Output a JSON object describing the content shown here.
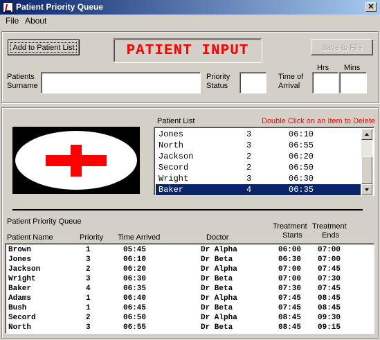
{
  "window": {
    "title": "Patient Priority Queue",
    "close_glyph": "✕"
  },
  "menu": [
    {
      "label": "File"
    },
    {
      "label": "About"
    }
  ],
  "input_panel": {
    "add_button": "Add to Patient List",
    "banner": "PATIENT INPUT",
    "save_button": "Save to File",
    "surname_label_1": "Patients",
    "surname_label_2": "Surname",
    "surname_value": "",
    "priority_label_1": "Priority",
    "priority_label_2": "Status",
    "priority_value": "",
    "arrival_label_1": "Time of",
    "arrival_label_2": "Arrival",
    "hrs_label": "Hrs",
    "mins_label": "Mins",
    "hrs_value": "",
    "mins_value": ""
  },
  "patient_list": {
    "label": "Patient List",
    "hint": "Double Click on an Item to Delete",
    "hint_color": "#ff0000",
    "rows": [
      {
        "name": "Jones",
        "priority": "3",
        "time": "06:10"
      },
      {
        "name": "North",
        "priority": "3",
        "time": "06:55"
      },
      {
        "name": "Jackson",
        "priority": "2",
        "time": "06:20"
      },
      {
        "name": "Secord",
        "priority": "2",
        "time": "06:50"
      },
      {
        "name": "Wright",
        "priority": "3",
        "time": "06:30"
      },
      {
        "name": "Baker",
        "priority": "4",
        "time": "06:35"
      }
    ],
    "selected_index": 5
  },
  "queue": {
    "title": "Patient Priority Queue",
    "headers": {
      "name": "Patient Name",
      "priority": "Priority",
      "time": "Time Arrived",
      "doctor": "Doctor",
      "starts_1": "Treatment",
      "starts_2": "Starts",
      "ends_1": "Treatment",
      "ends_2": "Ends"
    },
    "rows": [
      {
        "name": "Brown",
        "priority": "1",
        "time": "05:45",
        "doctor": "Dr Alpha",
        "starts": "06:00",
        "ends": "07:00"
      },
      {
        "name": "Jones",
        "priority": "3",
        "time": "06:10",
        "doctor": "Dr Beta",
        "starts": "06:30",
        "ends": "07:00"
      },
      {
        "name": "Jackson",
        "priority": "2",
        "time": "06:20",
        "doctor": "Dr Alpha",
        "starts": "07:00",
        "ends": "07:45"
      },
      {
        "name": "Wright",
        "priority": "3",
        "time": "06:30",
        "doctor": "Dr Beta",
        "starts": "07:00",
        "ends": "07:30"
      },
      {
        "name": "Baker",
        "priority": "4",
        "time": "06:35",
        "doctor": "Dr Beta",
        "starts": "07:30",
        "ends": "07:45"
      },
      {
        "name": "Adams",
        "priority": "1",
        "time": "06:40",
        "doctor": "Dr Alpha",
        "starts": "07:45",
        "ends": "08:45"
      },
      {
        "name": "Bush",
        "priority": "1",
        "time": "06:45",
        "doctor": "Dr Beta",
        "starts": "07:45",
        "ends": "08:45"
      },
      {
        "name": "Secord",
        "priority": "2",
        "time": "06:50",
        "doctor": "Dr Alpha",
        "starts": "08:45",
        "ends": "09:30"
      },
      {
        "name": "North",
        "priority": "3",
        "time": "06:55",
        "doctor": "Dr Beta",
        "starts": "08:45",
        "ends": "09:15"
      }
    ]
  }
}
